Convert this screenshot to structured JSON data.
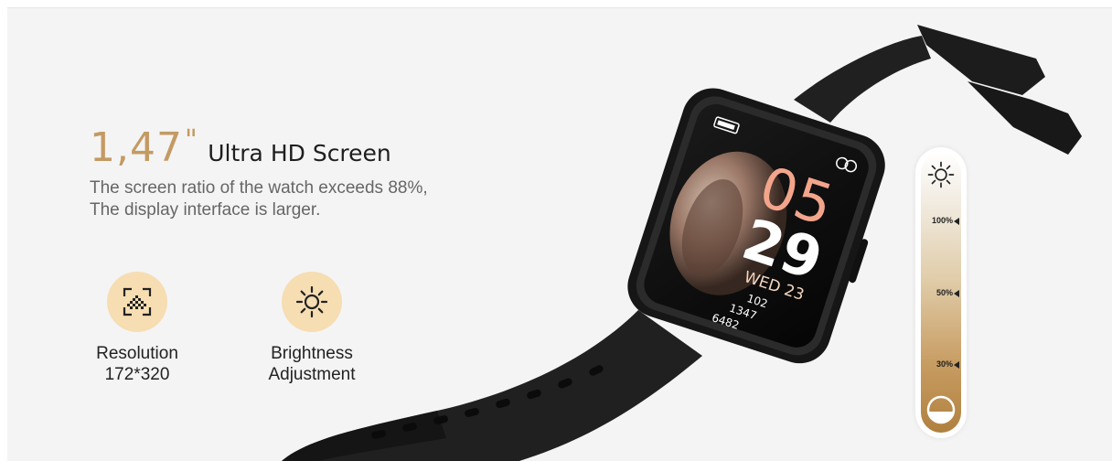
{
  "headline": {
    "size_value": "1,47",
    "size_mark": "\"",
    "title": "Ultra HD Screen"
  },
  "description": {
    "line1": "The screen ratio of the watch exceeds 88%,",
    "line2": "The display interface is larger."
  },
  "features": [
    {
      "icon": "resolution-icon",
      "line1": "Resolution",
      "line2": "172*320"
    },
    {
      "icon": "brightness-icon",
      "line1": "Brightness",
      "line2": "Adjustment"
    }
  ],
  "brightness_scale": {
    "levels": [
      "100%",
      "50%",
      "30%"
    ],
    "top_icon": "sun-icon",
    "bottom_icon": "dim-icon"
  },
  "watch_screen": {
    "hour": "05",
    "minute": "29",
    "date": "WED 23",
    "heart_rate": "102",
    "calories": "1347",
    "steps": "6482"
  },
  "colors": {
    "accent_gold": "#c49a63",
    "icon_bg": "#f6ddb2",
    "hour_color": "#f3a58c"
  }
}
